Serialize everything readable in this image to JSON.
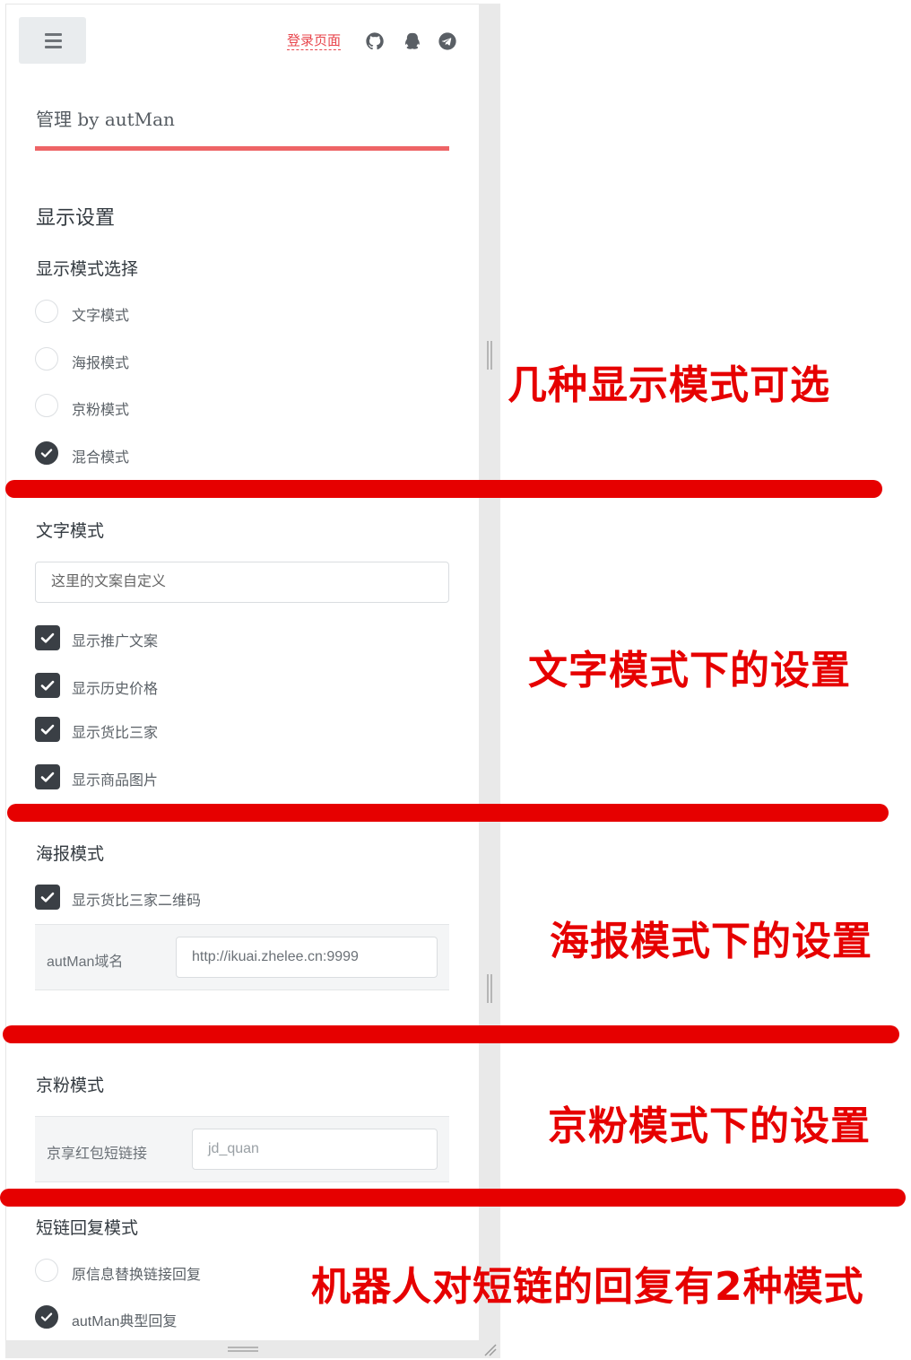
{
  "header": {
    "login_link": "登录页面",
    "icons": [
      "menu-icon",
      "github-icon",
      "qq-icon",
      "telegram-icon"
    ]
  },
  "brand": {
    "title": "管理 by autMan"
  },
  "display_settings": {
    "title": "显示设置",
    "mode_select_title": "显示模式选择",
    "modes": [
      {
        "label": "文字模式",
        "selected": false
      },
      {
        "label": "海报模式",
        "selected": false
      },
      {
        "label": "京粉模式",
        "selected": false
      },
      {
        "label": "混合模式",
        "selected": true
      }
    ]
  },
  "text_mode": {
    "title": "文字模式",
    "input_value": "这里的文案自定义",
    "options": [
      {
        "label": "显示推广文案",
        "checked": true
      },
      {
        "label": "显示历史价格",
        "checked": true
      },
      {
        "label": "显示货比三家",
        "checked": true
      },
      {
        "label": "显示商品图片",
        "checked": true
      }
    ]
  },
  "poster_mode": {
    "title": "海报模式",
    "qr_option": {
      "label": "显示货比三家二维码",
      "checked": true
    },
    "domain_label": "autMan域名",
    "domain_value": "http://ikuai.zhelee.cn:9999"
  },
  "jingfen_mode": {
    "title": "京粉模式",
    "short_link_label": "京享红包短链接",
    "short_link_placeholder": "jd_quan"
  },
  "short_link_reply": {
    "title": "短链回复模式",
    "options": [
      {
        "label": "原信息替换链接回复",
        "selected": false
      },
      {
        "label": "autMan典型回复",
        "selected": true
      }
    ]
  },
  "annotations": {
    "a1": "几种显示模式可选",
    "a2": "文字模式下的设置",
    "a3": "海报模式下的设置",
    "a4": "京粉模式下的设置",
    "a5": "机器人对短链的回复有2种模式"
  },
  "colors": {
    "accent": "#e8474e",
    "annotation_red": "#e60000",
    "control_dark": "#3a3f45"
  }
}
